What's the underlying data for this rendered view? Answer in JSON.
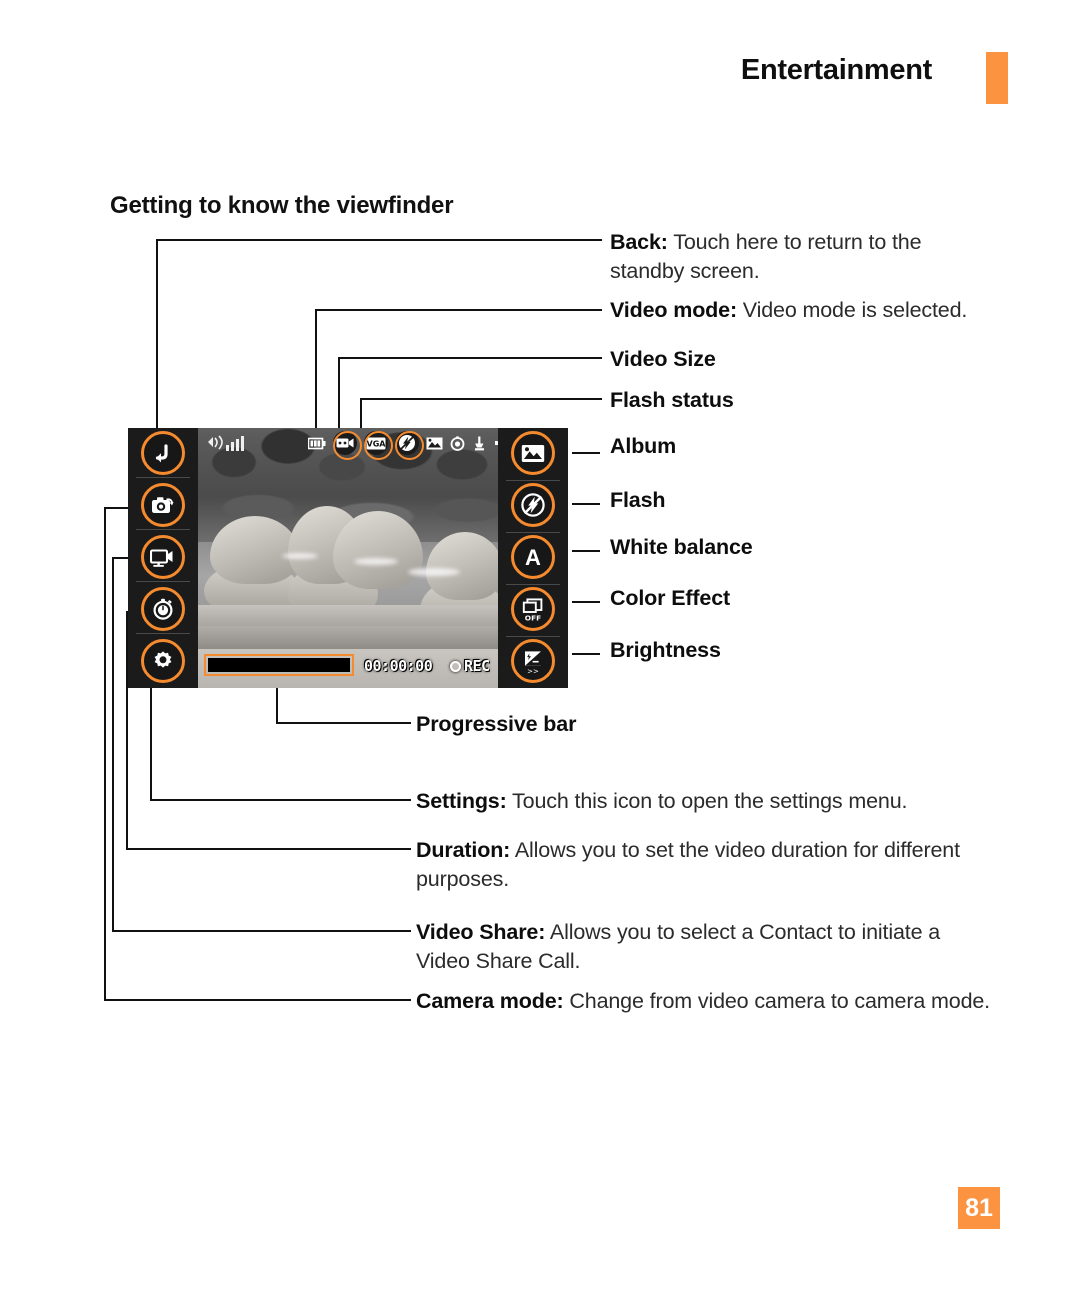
{
  "header": {
    "title": "Entertainment",
    "accent_color": "#fb9341"
  },
  "section": {
    "heading": "Getting to know the viewfinder"
  },
  "page_number": "81",
  "callouts": [
    {
      "label": "Back:",
      "text": " Touch here to return to the standby screen."
    },
    {
      "label": "Video mode:",
      "text": " Video mode is selected."
    },
    {
      "label": "Video Size",
      "text": ""
    },
    {
      "label": "Flash status",
      "text": ""
    },
    {
      "label": "Album",
      "text": ""
    },
    {
      "label": "Flash",
      "text": ""
    },
    {
      "label": "White balance",
      "text": ""
    },
    {
      "label": "Color Effect",
      "text": ""
    },
    {
      "label": "Brightness",
      "text": ""
    },
    {
      "label": "Progressive bar",
      "text": ""
    },
    {
      "label": "Settings:",
      "text": " Touch this icon to open the settings menu."
    },
    {
      "label": "Duration:",
      "text": " Allows you to set the video duration for different purposes."
    },
    {
      "label": "Video Share:",
      "text": " Allows you to select a Contact to initiate a Video Share Call."
    },
    {
      "label": "Camera mode:",
      "text": " Change from video camera to camera mode."
    }
  ],
  "viewfinder": {
    "left_buttons": [
      {
        "name": "back-button",
        "icon": "back-arrow-icon"
      },
      {
        "name": "camera-mode-button",
        "icon": "camera-icon"
      },
      {
        "name": "video-share-button",
        "icon": "video-share-icon"
      },
      {
        "name": "duration-button",
        "icon": "stopwatch-icon"
      },
      {
        "name": "settings-button",
        "icon": "gear-icon"
      }
    ],
    "right_buttons": [
      {
        "name": "album-button",
        "icon": "album-picture-icon"
      },
      {
        "name": "flash-button",
        "icon": "flash-off-icon"
      },
      {
        "name": "white-balance-button",
        "icon": "white-balance-auto-icon",
        "label": "A"
      },
      {
        "name": "color-effect-button",
        "icon": "color-effect-icon",
        "label": "OFF"
      },
      {
        "name": "brightness-button",
        "icon": "brightness-icon",
        "label": ">>"
      }
    ],
    "status_icons": [
      {
        "name": "battery-icon",
        "highlighted": false
      },
      {
        "name": "video-mode-icon",
        "highlighted": true
      },
      {
        "name": "video-size-vga-icon",
        "highlighted": true,
        "label": "VGA"
      },
      {
        "name": "flash-status-icon",
        "highlighted": true
      },
      {
        "name": "scene-mode-icon",
        "highlighted": false
      },
      {
        "name": "timer-icon",
        "highlighted": false
      },
      {
        "name": "macro-icon",
        "highlighted": false
      },
      {
        "name": "speaker-icon",
        "highlighted": false
      },
      {
        "name": "storage-phone-icon",
        "highlighted": false
      }
    ],
    "signal_label": "signal-strength-icon",
    "timer_value": "00:00:00",
    "rec_label": "REC",
    "progress_percent": 100,
    "accent_color": "#f58a2e",
    "body_color": "#1b1b1b"
  }
}
